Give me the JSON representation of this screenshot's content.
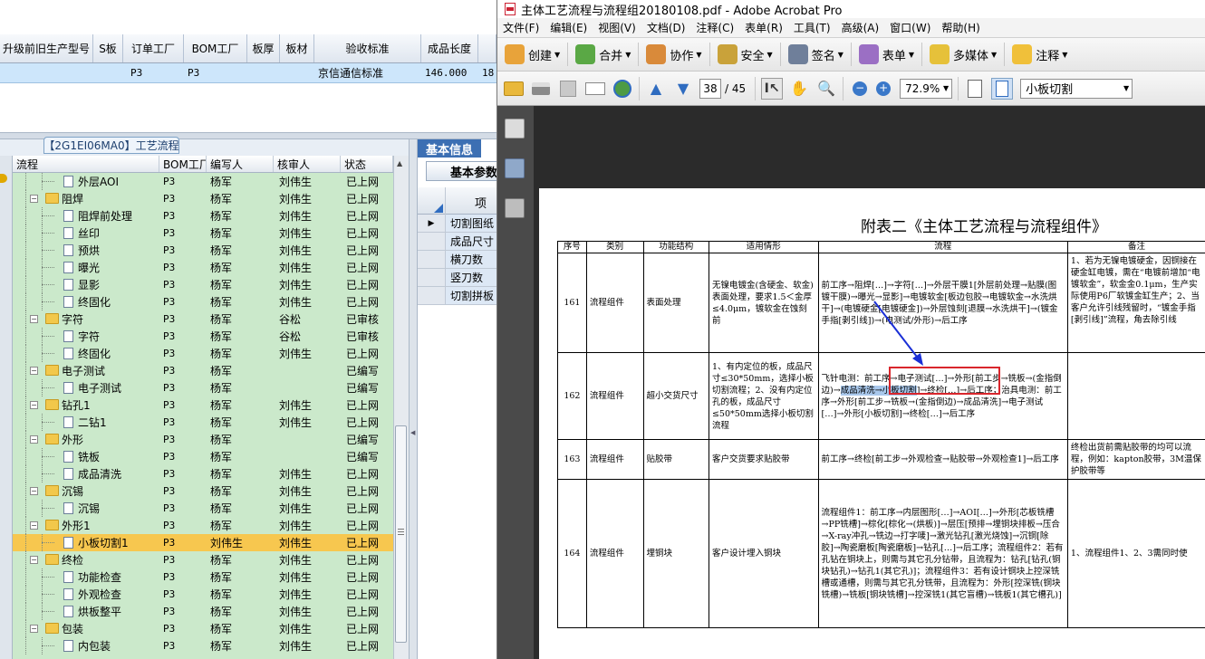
{
  "left_app": {
    "top_table": {
      "headers": [
        "升级前旧生产型号",
        "S板",
        "订单工厂",
        "BOM工厂",
        "板厚",
        "板材",
        "验收标准",
        "成品长度",
        ""
      ],
      "row": [
        "",
        "",
        "P3",
        "P3",
        "",
        "",
        "京信通信标准",
        "146.000",
        "18"
      ]
    },
    "panel_title": "【2G1EI06MA0】工艺流程",
    "tree": {
      "headers": [
        "流程",
        "BOM工厂",
        "编写人",
        "核审人",
        "状态"
      ],
      "rows": [
        {
          "level": 2,
          "type": "doc",
          "name": "外层AOI",
          "bom": "P3",
          "writer": "杨军",
          "reviewer": "刘伟生",
          "status": "已上网"
        },
        {
          "level": 1,
          "type": "folder",
          "name": "阻焊",
          "bom": "P3",
          "writer": "杨军",
          "reviewer": "刘伟生",
          "status": "已上网"
        },
        {
          "level": 2,
          "type": "doc",
          "name": "阻焊前处理",
          "bom": "P3",
          "writer": "杨军",
          "reviewer": "刘伟生",
          "status": "已上网"
        },
        {
          "level": 2,
          "type": "doc",
          "name": "丝印",
          "bom": "P3",
          "writer": "杨军",
          "reviewer": "刘伟生",
          "status": "已上网"
        },
        {
          "level": 2,
          "type": "doc",
          "name": "预烘",
          "bom": "P3",
          "writer": "杨军",
          "reviewer": "刘伟生",
          "status": "已上网"
        },
        {
          "level": 2,
          "type": "doc",
          "name": "曝光",
          "bom": "P3",
          "writer": "杨军",
          "reviewer": "刘伟生",
          "status": "已上网"
        },
        {
          "level": 2,
          "type": "doc",
          "name": "显影",
          "bom": "P3",
          "writer": "杨军",
          "reviewer": "刘伟生",
          "status": "已上网"
        },
        {
          "level": 2,
          "type": "doc",
          "name": "终固化",
          "bom": "P3",
          "writer": "杨军",
          "reviewer": "刘伟生",
          "status": "已上网"
        },
        {
          "level": 1,
          "type": "folder",
          "name": "字符",
          "bom": "P3",
          "writer": "杨军",
          "reviewer": "谷松",
          "status": "已审核"
        },
        {
          "level": 2,
          "type": "doc",
          "name": "字符",
          "bom": "P3",
          "writer": "杨军",
          "reviewer": "谷松",
          "status": "已审核"
        },
        {
          "level": 2,
          "type": "doc",
          "name": "终固化",
          "bom": "P3",
          "writer": "杨军",
          "reviewer": "刘伟生",
          "status": "已上网"
        },
        {
          "level": 1,
          "type": "folder",
          "name": "电子测试",
          "bom": "P3",
          "writer": "杨军",
          "reviewer": "",
          "status": "已编写"
        },
        {
          "level": 2,
          "type": "doc",
          "name": "电子测试",
          "bom": "P3",
          "writer": "杨军",
          "reviewer": "",
          "status": "已编写"
        },
        {
          "level": 1,
          "type": "folder",
          "name": "钻孔1",
          "bom": "P3",
          "writer": "杨军",
          "reviewer": "刘伟生",
          "status": "已上网"
        },
        {
          "level": 2,
          "type": "doc",
          "name": "二钻1",
          "bom": "P3",
          "writer": "杨军",
          "reviewer": "刘伟生",
          "status": "已上网"
        },
        {
          "level": 1,
          "type": "folder",
          "name": "外形",
          "bom": "P3",
          "writer": "杨军",
          "reviewer": "",
          "status": "已编写"
        },
        {
          "level": 2,
          "type": "doc",
          "name": "铣板",
          "bom": "P3",
          "writer": "杨军",
          "reviewer": "",
          "status": "已编写"
        },
        {
          "level": 2,
          "type": "doc",
          "name": "成品清洗",
          "bom": "P3",
          "writer": "杨军",
          "reviewer": "刘伟生",
          "status": "已上网"
        },
        {
          "level": 1,
          "type": "folder",
          "name": "沉锡",
          "bom": "P3",
          "writer": "杨军",
          "reviewer": "刘伟生",
          "status": "已上网"
        },
        {
          "level": 2,
          "type": "doc",
          "name": "沉锡",
          "bom": "P3",
          "writer": "杨军",
          "reviewer": "刘伟生",
          "status": "已上网"
        },
        {
          "level": 1,
          "type": "folder",
          "name": "外形1",
          "bom": "P3",
          "writer": "杨军",
          "reviewer": "刘伟生",
          "status": "已上网"
        },
        {
          "level": 2,
          "type": "doc",
          "name": "小板切割1",
          "bom": "P3",
          "writer": "刘伟生",
          "reviewer": "刘伟生",
          "status": "已上网",
          "selected": true
        },
        {
          "level": 1,
          "type": "folder",
          "name": "终检",
          "bom": "P3",
          "writer": "杨军",
          "reviewer": "刘伟生",
          "status": "已上网"
        },
        {
          "level": 2,
          "type": "doc",
          "name": "功能检查",
          "bom": "P3",
          "writer": "杨军",
          "reviewer": "刘伟生",
          "status": "已上网"
        },
        {
          "level": 2,
          "type": "doc",
          "name": "外观检查",
          "bom": "P3",
          "writer": "杨军",
          "reviewer": "刘伟生",
          "status": "已上网"
        },
        {
          "level": 2,
          "type": "doc",
          "name": "烘板整平",
          "bom": "P3",
          "writer": "杨军",
          "reviewer": "刘伟生",
          "status": "已上网"
        },
        {
          "level": 1,
          "type": "folder",
          "name": "包装",
          "bom": "P3",
          "writer": "杨军",
          "reviewer": "刘伟生",
          "status": "已上网"
        },
        {
          "level": 2,
          "type": "doc",
          "name": "内包装",
          "bom": "P3",
          "writer": "杨军",
          "reviewer": "刘伟生",
          "status": "已上网"
        }
      ]
    },
    "info_panel": {
      "tab": "基本信息",
      "subtab": "基本参数",
      "column_header": "项目",
      "rows": [
        "切割图纸",
        "成品尺寸",
        "横刀数",
        "竖刀数",
        "切割拼板"
      ]
    }
  },
  "acrobat": {
    "title": "主体工艺流程与流程组20180108.pdf - Adobe Acrobat Pro",
    "menu": [
      "文件(F)",
      "编辑(E)",
      "视图(V)",
      "文档(D)",
      "注释(C)",
      "表单(R)",
      "工具(T)",
      "高级(A)",
      "窗口(W)",
      "帮助(H)"
    ],
    "toolbar": [
      {
        "label": "创建",
        "icon": "create-icon",
        "color": "#e8a33a"
      },
      {
        "label": "合并",
        "icon": "combine-icon",
        "color": "#5aa845"
      },
      {
        "label": "协作",
        "icon": "collaborate-icon",
        "color": "#d98a3a"
      },
      {
        "label": "安全",
        "icon": "lock-icon",
        "color": "#c9a23a"
      },
      {
        "label": "签名",
        "icon": "pen-icon",
        "color": "#6f7f9a"
      },
      {
        "label": "表单",
        "icon": "form-icon",
        "color": "#9b6fc4"
      },
      {
        "label": "多媒体",
        "icon": "multimedia-icon",
        "color": "#e6c13a"
      },
      {
        "label": "注释",
        "icon": "comment-icon",
        "color": "#f0c03a"
      }
    ],
    "page_current": "38",
    "page_total": "/ 45",
    "zoom": "72.9%",
    "find_value": "小板切割",
    "doc": {
      "title": "附表二《主体工艺流程与流程组件》",
      "headers": [
        "序号",
        "类别",
        "功能结构",
        "适用情形",
        "流程",
        "备注"
      ],
      "rows": [
        {
          "no": "161",
          "cat": "流程组件",
          "func": "表面处理",
          "case": "无镍电镀金(含硬金、软金)表面处理，要求1.5＜金厚≤4.0μm，镀软金在蚀刻前",
          "flow": "前工序→阻焊[…]→字符[…]→外层干膜1[外层前处理→贴膜(图镀干膜)→曝光→显影]→电镀软金[板边包胶→电镀软金→水洗烘干]→(电镀硬金[电镀硬金])→外层蚀刻[退膜→水洗烘干]→(镀金手指[剥引线])→(电测试/外形)→后工序",
          "note": "1、若为无镍电镀硬金，因铜接在硬金缸电镀，需在“电镀前增加“电镀软金”，软金金0.1μm，生产实际使用P6厂软镀金缸生产；2、当客户允许引线残留时，“镀金手指[剥引线]”流程，角去除引线"
        },
        {
          "no": "162",
          "cat": "流程组件",
          "func": "超小交货尺寸",
          "case": "1、有内定位的板，成品尺寸≤30*50mm，选择小板切割流程；2、没有内定位孔的板，成品尺寸≤50*50mm选择小板切割流程",
          "flow_a": "飞针电测：前工序→电子测试[…]→外形[前工步→铣板→(金指倒边)→",
          "flow_hl": "成品清洗→小板切割",
          "flow_b": "]→终检[…]→后工序；治具电测：前工序→外形[前工步→铣板→(金指倒边)→成品清洗]→电子测试[…]→外形[小板切割]→终检[…]→后工序",
          "note": ""
        },
        {
          "no": "163",
          "cat": "流程组件",
          "func": "贴胶带",
          "case": "客户交货要求贴胶带",
          "flow": "前工序→终检[前工步→外观检查→贴胶带→外观检查1]→后工序",
          "note": "终检出货前需贴胶带的均可以流程，例如：kapton胶带，3M温保护胶带等"
        },
        {
          "no": "164",
          "cat": "流程组件",
          "func": "埋铜块",
          "case": "客户设计埋入铜块",
          "flow": "流程组件1：前工序→内层图形[…]→AOI[…]→外形[芯板铣槽→PP铣槽]→棕化[棕化→(烘板)]→层压[预排→埋铜块排板→压合→X-ray冲孔→铣边→打字唛]→激光钻孔[激光烧蚀]→沉铜[除胶]→陶瓷磨板[陶瓷磨板]→钻孔[…]→后工序；流程组件2：若有孔钻在铜块上，则需与其它孔分钻带，且流程为：钻孔[钻孔(铜块钻孔)→钻孔1(其它孔)]；流程组件3：若有设计铜块上控深铣槽或通槽，则需与其它孔分铣带，且流程为：外形[控深铣(铜块铣槽)→铣板[铜块铣槽]→控深铣1(其它盲槽)→铣板1(其它槽孔)]",
          "note": "1、流程组件1、2、3需同时使"
        }
      ]
    }
  }
}
